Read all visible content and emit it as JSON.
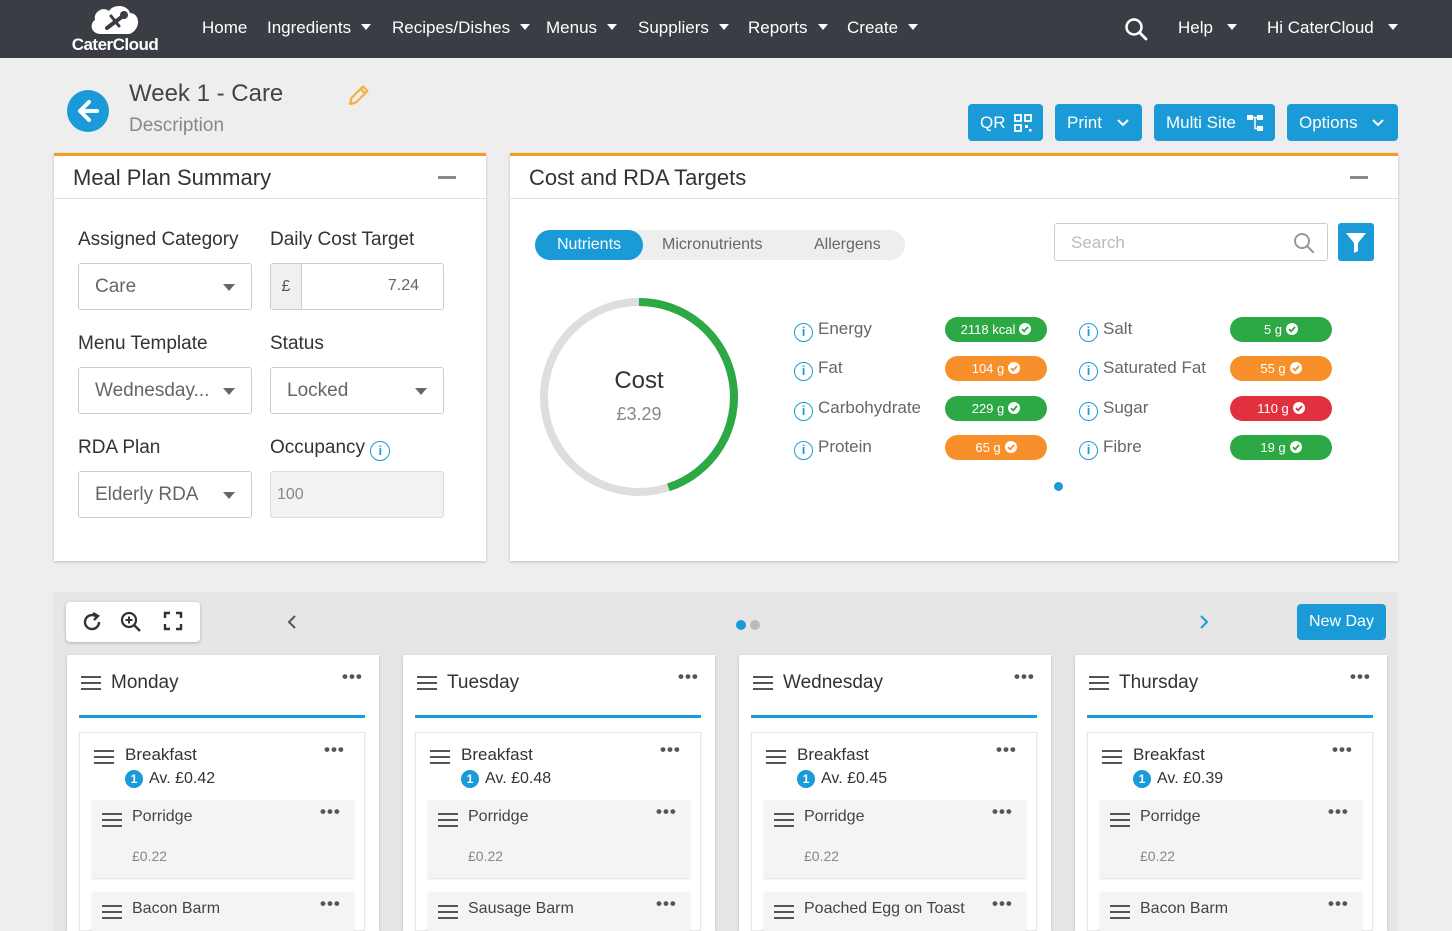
{
  "brand": {
    "name": "CaterCloud",
    "accent": "#1a9bd7",
    "nav_bg": "#3a3d44",
    "panel_border": "#f0a020"
  },
  "nav": {
    "items": [
      {
        "label": "Home",
        "dropdown": false
      },
      {
        "label": "Ingredients",
        "dropdown": true
      },
      {
        "label": "Recipes/Dishes",
        "dropdown": true
      },
      {
        "label": "Menus",
        "dropdown": true
      },
      {
        "label": "Suppliers",
        "dropdown": true
      },
      {
        "label": "Reports",
        "dropdown": true
      },
      {
        "label": "Create",
        "dropdown": true
      }
    ],
    "help": "Help",
    "user": "Hi CaterCloud"
  },
  "header": {
    "title": "Week 1 - Care",
    "description": "Description",
    "buttons": {
      "qr": "QR",
      "print": "Print",
      "multisite": "Multi Site",
      "options": "Options"
    }
  },
  "summary": {
    "title": "Meal Plan Summary",
    "assigned_category_label": "Assigned Category",
    "assigned_category_value": "Care",
    "daily_cost_label": "Daily Cost Target",
    "currency": "£",
    "daily_cost_value": "7.24",
    "menu_template_label": "Menu Template",
    "menu_template_value": "Wednesday...",
    "status_label": "Status",
    "status_value": "Locked",
    "rda_plan_label": "RDA Plan",
    "rda_plan_value": "Elderly RDA",
    "occupancy_label": "Occupancy",
    "occupancy_value": "100"
  },
  "targets": {
    "title": "Cost and RDA Targets",
    "tabs": [
      "Nutrients",
      "Micronutrients",
      "Allergens"
    ],
    "active_tab": "Nutrients",
    "search_placeholder": "Search",
    "cost_label": "Cost",
    "cost_value": "£3.29",
    "cost_fraction": 0.45,
    "nutrients": [
      {
        "name": "Energy",
        "value": "2118 kcal",
        "color": "#2ca844"
      },
      {
        "name": "Fat",
        "value": "104 g",
        "color": "#f7902a"
      },
      {
        "name": "Carbohydrate",
        "value": "229 g",
        "color": "#2ca844"
      },
      {
        "name": "Protein",
        "value": "65 g",
        "color": "#f7902a"
      },
      {
        "name": "Salt",
        "value": "5 g",
        "color": "#2ca844"
      },
      {
        "name": "Saturated Fat",
        "value": "55 g",
        "color": "#f7902a"
      },
      {
        "name": "Sugar",
        "value": "110 g",
        "color": "#e2313e"
      },
      {
        "name": "Fibre",
        "value": "19 g",
        "color": "#2ca844"
      }
    ]
  },
  "board": {
    "new_day": "New Day",
    "days": [
      {
        "name": "Monday",
        "meal": "Breakfast",
        "count": "1",
        "avg": "Av. £0.42",
        "dishes": [
          {
            "name": "Porridge",
            "cost": "£0.22"
          },
          {
            "name": "Bacon Barm"
          }
        ]
      },
      {
        "name": "Tuesday",
        "meal": "Breakfast",
        "count": "1",
        "avg": "Av. £0.48",
        "dishes": [
          {
            "name": "Porridge",
            "cost": "£0.22"
          },
          {
            "name": "Sausage Barm"
          }
        ]
      },
      {
        "name": "Wednesday",
        "meal": "Breakfast",
        "count": "1",
        "avg": "Av. £0.45",
        "dishes": [
          {
            "name": "Porridge",
            "cost": "£0.22"
          },
          {
            "name": "Poached Egg on Toast"
          }
        ]
      },
      {
        "name": "Thursday",
        "meal": "Breakfast",
        "count": "1",
        "avg": "Av. £0.39",
        "dishes": [
          {
            "name": "Porridge",
            "cost": "£0.22"
          },
          {
            "name": "Bacon Barm"
          }
        ]
      }
    ]
  }
}
